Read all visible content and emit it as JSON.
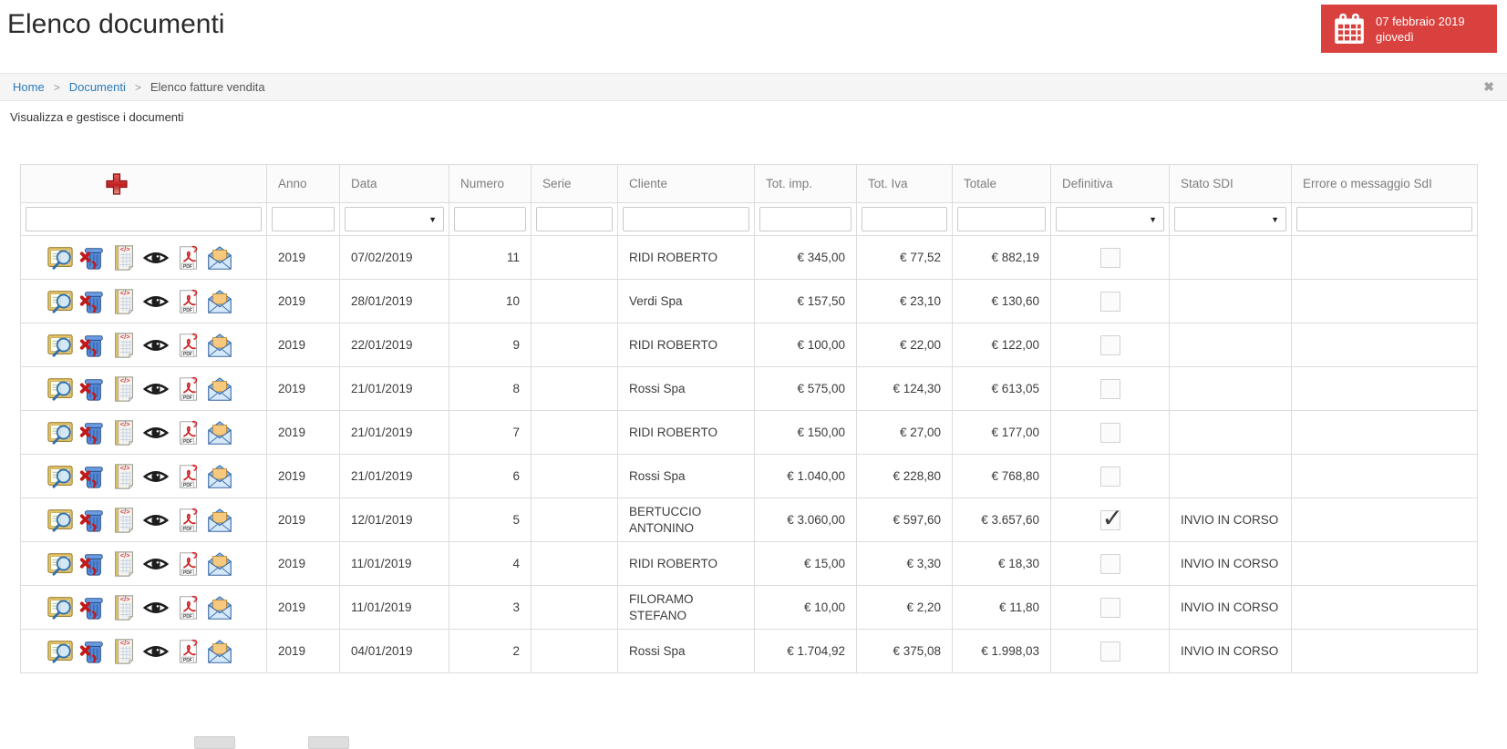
{
  "colors": {
    "accent_red": "#d9413e",
    "link_blue": "#2b7bb9"
  },
  "page": {
    "title": "Elenco documenti",
    "subtitle": "Visualizza e gestisce i documenti"
  },
  "date_widget": {
    "date": "07 febbraio 2019",
    "weekday": "giovedì"
  },
  "breadcrumb": {
    "items": [
      "Home",
      "Documenti",
      "Elenco fatture vendita"
    ],
    "separator": ">",
    "close_icon": "✖"
  },
  "table": {
    "columns": {
      "anno": "Anno",
      "data": "Data",
      "numero": "Numero",
      "serie": "Serie",
      "cliente": "Cliente",
      "tot_imp": "Tot. imp.",
      "tot_iva": "Tot. Iva",
      "totale": "Totale",
      "definitiva": "Definitiva",
      "stato_sdi": "Stato SDI",
      "errore": "Errore o messaggio SdI"
    },
    "row_action_icons": [
      "view-document",
      "delete-document",
      "xml-invoice",
      "preview-eye",
      "pdf-export",
      "send-email"
    ],
    "rows": [
      {
        "anno": "2019",
        "data": "07/02/2019",
        "numero": "11",
        "serie": "",
        "cliente": "RIDI ROBERTO",
        "tot_imp": "€ 345,00",
        "tot_iva": "€ 77,52",
        "totale": "€ 882,19",
        "definitiva": false,
        "stato_sdi": "",
        "errore": ""
      },
      {
        "anno": "2019",
        "data": "28/01/2019",
        "numero": "10",
        "serie": "",
        "cliente": "Verdi Spa",
        "tot_imp": "€ 157,50",
        "tot_iva": "€ 23,10",
        "totale": "€ 130,60",
        "definitiva": false,
        "stato_sdi": "",
        "errore": ""
      },
      {
        "anno": "2019",
        "data": "22/01/2019",
        "numero": "9",
        "serie": "",
        "cliente": "RIDI ROBERTO",
        "tot_imp": "€ 100,00",
        "tot_iva": "€ 22,00",
        "totale": "€ 122,00",
        "definitiva": false,
        "stato_sdi": "",
        "errore": ""
      },
      {
        "anno": "2019",
        "data": "21/01/2019",
        "numero": "8",
        "serie": "",
        "cliente": "Rossi Spa",
        "tot_imp": "€ 575,00",
        "tot_iva": "€ 124,30",
        "totale": "€ 613,05",
        "definitiva": false,
        "stato_sdi": "",
        "errore": ""
      },
      {
        "anno": "2019",
        "data": "21/01/2019",
        "numero": "7",
        "serie": "",
        "cliente": "RIDI ROBERTO",
        "tot_imp": "€ 150,00",
        "tot_iva": "€ 27,00",
        "totale": "€ 177,00",
        "definitiva": false,
        "stato_sdi": "",
        "errore": ""
      },
      {
        "anno": "2019",
        "data": "21/01/2019",
        "numero": "6",
        "serie": "",
        "cliente": "Rossi Spa",
        "tot_imp": "€ 1.040,00",
        "tot_iva": "€ 228,80",
        "totale": "€ 768,80",
        "definitiva": false,
        "stato_sdi": "",
        "errore": ""
      },
      {
        "anno": "2019",
        "data": "12/01/2019",
        "numero": "5",
        "serie": "",
        "cliente": "BERTUCCIO ANTONINO",
        "tot_imp": "€ 3.060,00",
        "tot_iva": "€ 597,60",
        "totale": "€ 3.657,60",
        "definitiva": true,
        "stato_sdi": "INVIO IN CORSO",
        "errore": ""
      },
      {
        "anno": "2019",
        "data": "11/01/2019",
        "numero": "4",
        "serie": "",
        "cliente": "RIDI ROBERTO",
        "tot_imp": "€ 15,00",
        "tot_iva": "€ 3,30",
        "totale": "€ 18,30",
        "definitiva": false,
        "stato_sdi": "INVIO IN CORSO",
        "errore": ""
      },
      {
        "anno": "2019",
        "data": "11/01/2019",
        "numero": "3",
        "serie": "",
        "cliente": "FILORAMO STEFANO",
        "tot_imp": "€ 10,00",
        "tot_iva": "€ 2,20",
        "totale": "€ 11,80",
        "definitiva": false,
        "stato_sdi": "INVIO IN CORSO",
        "errore": ""
      },
      {
        "anno": "2019",
        "data": "04/01/2019",
        "numero": "2",
        "serie": "",
        "cliente": "Rossi Spa",
        "tot_imp": "€ 1.704,92",
        "tot_iva": "€ 375,08",
        "totale": "€ 1.998,03",
        "definitiva": false,
        "stato_sdi": "INVIO IN CORSO",
        "errore": ""
      }
    ]
  }
}
